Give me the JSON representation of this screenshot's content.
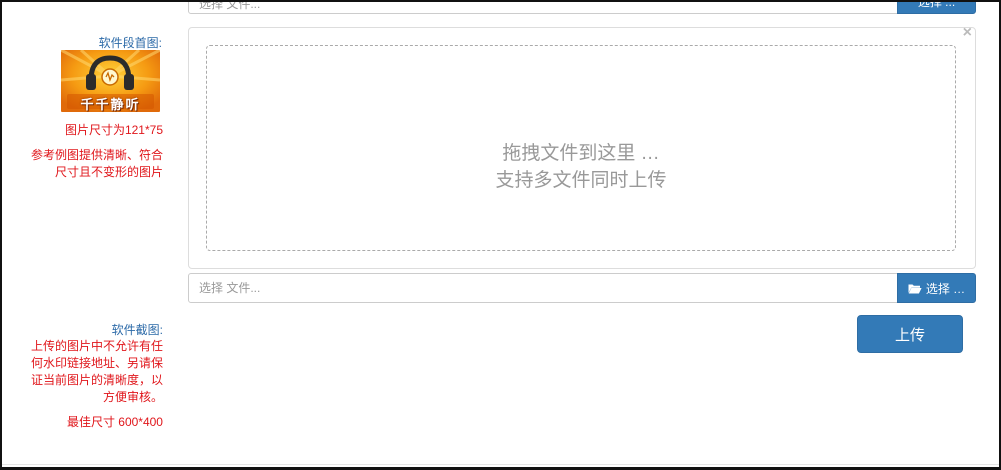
{
  "top_row": {
    "input_value": "选择 文件...",
    "button_label": "选择 ..."
  },
  "thumbnail": {
    "label": "软件段首图:",
    "image_caption": "千千静听",
    "size_note": "图片尺寸为121*75",
    "reference_note": "参考例图提供清晰、符合尺寸且不变形的图片"
  },
  "upload": {
    "drop_line_1": "拖拽文件到这里 …",
    "drop_line_2": "支持多文件同时上传",
    "close_glyph": "×",
    "file_placeholder": "选择 文件...",
    "browse_label": "选择 …",
    "upload_label": "上传"
  },
  "screenshot": {
    "label": "软件截图:",
    "note": "上传的图片中不允许有任何水印链接地址、另请保证当前图片的清晰度，以方便审核。",
    "best_size": "最佳尺寸 600*400"
  },
  "colors": {
    "primary": "#337ab7",
    "label_blue": "#2c6aa8",
    "warning_red": "#e0161b",
    "border": "#cccccc"
  },
  "icons": {
    "folder": "folder-open-icon",
    "close": "close-icon",
    "headphones": "headphones-icon"
  }
}
